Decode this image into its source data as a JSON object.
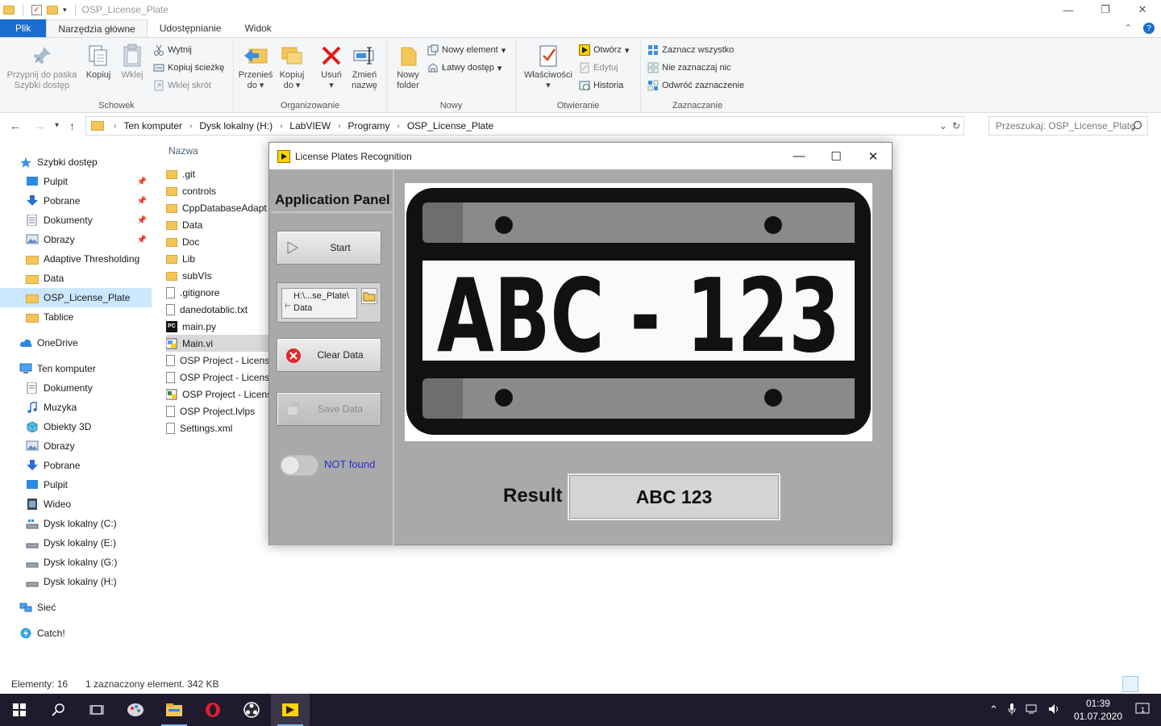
{
  "window": {
    "title": "OSP_License_Plate"
  },
  "ribbon": {
    "tabs": [
      {
        "label": "Plik"
      },
      {
        "label": "Narzędzia główne"
      },
      {
        "label": "Udostępnianie"
      },
      {
        "label": "Widok"
      }
    ],
    "clipboard": {
      "pin_label_1": "Przypnij do paska",
      "pin_label_2": "Szybki dostęp",
      "copy": "Kopiuj",
      "paste": "Wklej",
      "cut": "Wytnij",
      "copy_path": "Kopiuj ścieżkę",
      "paste_shortcut": "Wklej skrót",
      "group": "Schowek"
    },
    "organize": {
      "move_1": "Przenieś",
      "move_2": "do",
      "copyto_1": "Kopiuj",
      "copyto_2": "do",
      "delete": "Usuń",
      "rename_1": "Zmień",
      "rename_2": "nazwę",
      "group": "Organizowanie"
    },
    "new": {
      "new_item": "Nowy element",
      "easy_access": "Łatwy dostęp",
      "new_folder_1": "Nowy",
      "new_folder_2": "folder",
      "group": "Nowy"
    },
    "open": {
      "properties": "Właściwości",
      "open": "Otwórz",
      "edit": "Edytuj",
      "history": "Historia",
      "group": "Otwieranie"
    },
    "select": {
      "select_all": "Zaznacz wszystko",
      "select_none": "Nie zaznaczaj nic",
      "invert": "Odwróć zaznaczenie",
      "group": "Zaznaczanie"
    }
  },
  "address": {
    "crumbs": [
      "Ten komputer",
      "Dysk lokalny (H:)",
      "LabVIEW",
      "Programy",
      "OSP_License_Plate"
    ],
    "search_placeholder": "Przeszukaj: OSP_License_Plate"
  },
  "nav": {
    "quick_access": "Szybki dostęp",
    "pulpit": "Pulpit",
    "pobrane": "Pobrane",
    "dokumenty": "Dokumenty",
    "obrazy": "Obrazy",
    "adaptive": "Adaptive Thresholding",
    "data": "Data",
    "osp": "OSP_License_Plate",
    "tablice": "Tablice",
    "onedrive": "OneDrive",
    "this_pc": "Ten komputer",
    "pc_dokumenty": "Dokumenty",
    "pc_muzyka": "Muzyka",
    "pc_obiekty": "Obiekty 3D",
    "pc_obrazy": "Obrazy",
    "pc_pobrane": "Pobrane",
    "pc_pulpit": "Pulpit",
    "pc_wideo": "Wideo",
    "disk_c": "Dysk lokalny (C:)",
    "disk_e": "Dysk lokalny (E:)",
    "disk_g": "Dysk lokalny (G:)",
    "disk_h": "Dysk lokalny (H:)",
    "network": "Sieć",
    "catch": "Catch!"
  },
  "files": {
    "column": "Nazwa",
    "items": [
      {
        "name": ".git"
      },
      {
        "name": "controls"
      },
      {
        "name": "CppDatabaseAdapt"
      },
      {
        "name": "Data"
      },
      {
        "name": "Doc"
      },
      {
        "name": "Lib"
      },
      {
        "name": "subVIs"
      },
      {
        "name": ".gitignore"
      },
      {
        "name": "danedotablic.txt"
      },
      {
        "name": "main.py"
      },
      {
        "name": "Main.vi"
      },
      {
        "name": "OSP Project - Licens"
      },
      {
        "name": "OSP Project - Licens"
      },
      {
        "name": "OSP Project - Licens"
      },
      {
        "name": "OSP Project.lvlps"
      },
      {
        "name": "Settings.xml"
      }
    ]
  },
  "status": {
    "count": "Elementy: 16",
    "selection": "1 zaznaczony element. 342 KB"
  },
  "labview": {
    "title": "License Plates Recognition",
    "panel_title": "Application Panel",
    "start": "Start",
    "path_line1": "H:\\...se_Plate\\",
    "path_line2": "Data",
    "clear": "Clear Data",
    "save": "Save Data",
    "status": "NOT found",
    "plate_text": "ABC - 123",
    "result_label": "Result",
    "result_value": "ABC 123"
  },
  "taskbar": {
    "time": "01:39",
    "date": "01.07.2020",
    "notifications": "1"
  }
}
